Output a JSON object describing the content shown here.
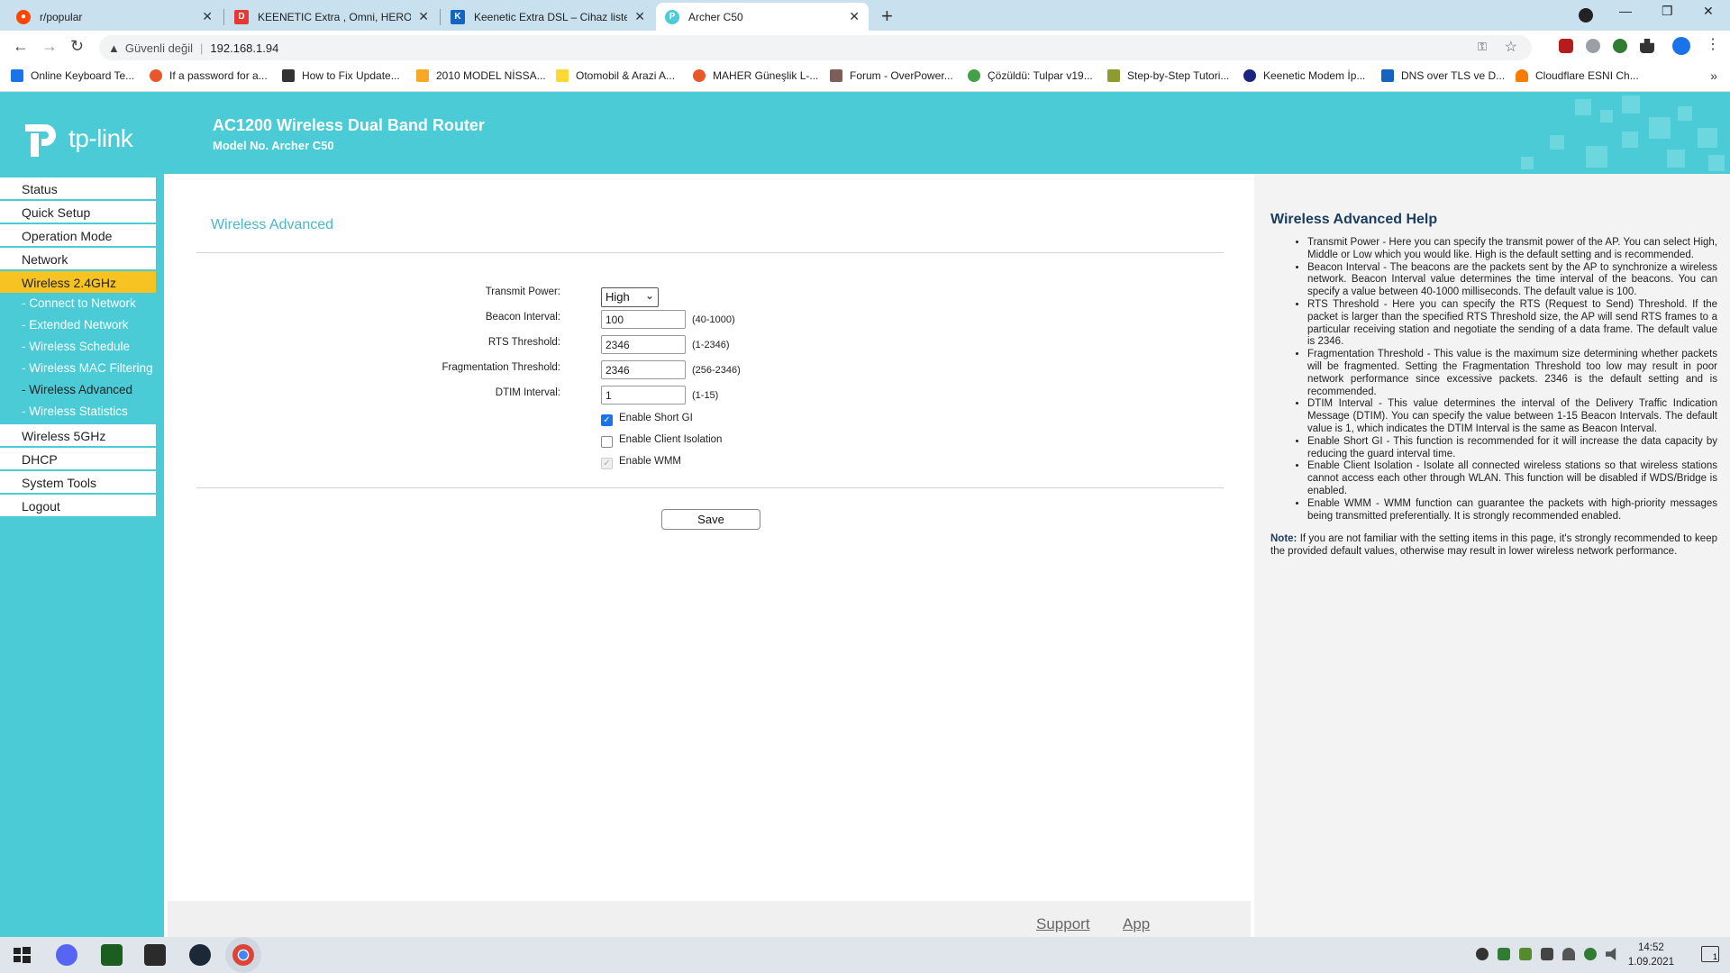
{
  "browser": {
    "tabs": [
      {
        "title": "r/popular",
        "favicon": "reddit-icon",
        "color": "#ff4500"
      },
      {
        "title": "KEENETIC Extra , Omni, HERO DS",
        "favicon": "dh-icon",
        "color": "#e53935"
      },
      {
        "title": "Keenetic Extra DSL – Cihaz listesi",
        "favicon": "keenetic-icon",
        "color": "#1565c0"
      },
      {
        "title": "Archer C50",
        "favicon": "tplink-icon",
        "color": "#4acbd6"
      }
    ],
    "address": {
      "security": "Güvenli değil",
      "url": "192.168.1.94"
    },
    "bookmarks": [
      {
        "label": "Online Keyboard Te...",
        "color": "#1a73e8"
      },
      {
        "label": "If a password for a...",
        "color": "#e8572a"
      },
      {
        "label": "How to Fix Update...",
        "color": "#333333"
      },
      {
        "label": "2010 MODEL NİSSA...",
        "color": "#f9a825"
      },
      {
        "label": "Otomobil & Arazi A...",
        "color": "#fdd835"
      },
      {
        "label": "MAHER Güneşlik L-...",
        "color": "#e8572a"
      },
      {
        "label": "Forum - OverPower...",
        "color": "#7b5e57"
      },
      {
        "label": "Çözüldü: Tulpar v19...",
        "color": "#43a047"
      },
      {
        "label": "Step-by-Step Tutori...",
        "color": "#8d9b2f"
      },
      {
        "label": "Keenetic Modem İp...",
        "color": "#1a237e"
      },
      {
        "label": "DNS over TLS ve D...",
        "color": "#1565c0"
      },
      {
        "label": "Cloudflare ESNI Ch...",
        "color": "#f57c00"
      }
    ]
  },
  "router": {
    "brand": "tp-link",
    "product": "AC1200 Wireless Dual Band Router",
    "model": "Model No. Archer C50",
    "menu": [
      {
        "label": "Status"
      },
      {
        "label": "Quick Setup"
      },
      {
        "label": "Operation Mode"
      },
      {
        "label": "Network"
      },
      {
        "label": "Wireless 2.4GHz"
      },
      {
        "label": "- Connect to Network"
      },
      {
        "label": "- Extended Network"
      },
      {
        "label": "- Wireless Schedule"
      },
      {
        "label": "- Wireless MAC Filtering"
      },
      {
        "label": "- Wireless Advanced"
      },
      {
        "label": "- Wireless Statistics"
      },
      {
        "label": "Wireless 5GHz"
      },
      {
        "label": "DHCP"
      },
      {
        "label": "System Tools"
      },
      {
        "label": "Logout"
      }
    ],
    "section_title": "Wireless Advanced",
    "form": {
      "transmit_power": {
        "label": "Transmit Power:",
        "value": "High"
      },
      "beacon_interval": {
        "label": "Beacon Interval:",
        "value": "100",
        "range": "(40-1000)"
      },
      "rts_threshold": {
        "label": "RTS Threshold:",
        "value": "2346",
        "range": "(1-2346)"
      },
      "frag_threshold": {
        "label": "Fragmentation Threshold:",
        "value": "2346",
        "range": "(256-2346)"
      },
      "dtim_interval": {
        "label": "DTIM Interval:",
        "value": "1",
        "range": "(1-15)"
      },
      "short_gi": {
        "label": "Enable Short GI",
        "checked": true
      },
      "client_isolation": {
        "label": "Enable Client Isolation",
        "checked": false
      },
      "wmm": {
        "label": "Enable WMM",
        "checked": true,
        "disabled": true
      },
      "save": "Save"
    },
    "footer": {
      "support": "Support",
      "app": "App"
    },
    "help": {
      "title": "Wireless Advanced Help",
      "items": [
        {
          "term": "Transmit Power",
          "text": " - Here you can specify the transmit power of the AP. You can select High, Middle or Low which you would like. High is the default setting and is recommended."
        },
        {
          "term": "Beacon Interval",
          "text": " - The beacons are the packets sent by the AP to synchronize a wireless network. Beacon Interval value determines the time interval of the beacons. You can specify a value between 40-1000 milliseconds. The default value is 100."
        },
        {
          "term": "RTS Threshold",
          "text": " - Here you can specify the RTS (Request to Send) Threshold. If the packet is larger than the specified RTS Threshold size, the AP will send RTS frames to a particular receiving station and negotiate the sending of a data frame. The default value is 2346."
        },
        {
          "term": "Fragmentation Threshold",
          "text": " - This value is the maximum size determining whether packets will be fragmented. Setting the Fragmentation Threshold too low may result in poor network performance since excessive packets. 2346 is the default setting and is recommended."
        },
        {
          "term": "DTIM Interval",
          "text": " - This value determines the interval of the Delivery Traffic Indication Message (DTIM). You can specify the value between 1-15 Beacon Intervals. The default value is 1, which indicates the DTIM Interval is the same as Beacon Interval."
        },
        {
          "term": "Enable Short GI",
          "text": " - This function is recommended for it will increase the data capacity by reducing the guard interval time."
        },
        {
          "term": "Enable Client Isolation",
          "text": " - Isolate all connected wireless stations so that wireless stations cannot access each other through WLAN. This function will be disabled if WDS/Bridge is enabled."
        },
        {
          "term": "Enable WMM",
          "text": " - WMM function can guarantee the packets with high-priority messages being transmitted preferentially. It is strongly recommended enabled."
        }
      ],
      "note_label": "Note:",
      "note": " If you are not familiar with the setting items in this page, it's strongly recommended to keep the provided default values, otherwise may result in lower wireless network performance."
    }
  },
  "taskbar": {
    "time": "14:52",
    "date": "1.09.2021",
    "notification_count": "1"
  }
}
